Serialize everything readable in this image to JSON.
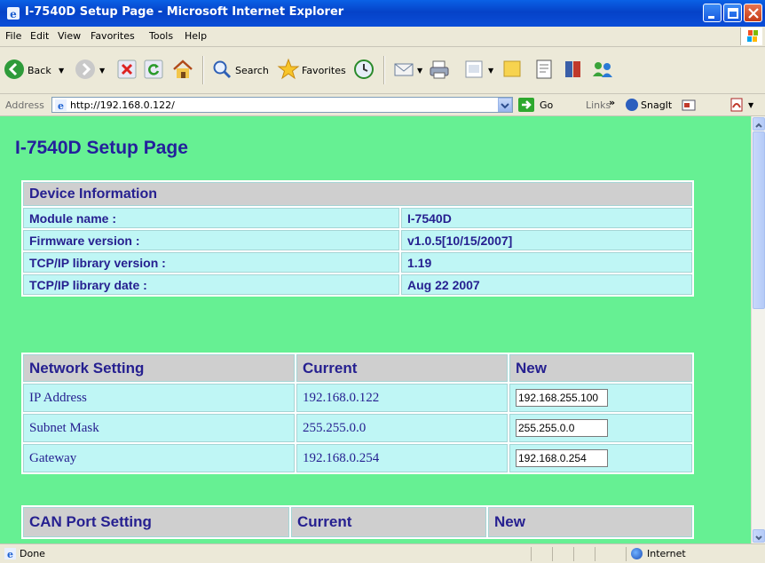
{
  "window": {
    "title": "I-7540D Setup Page - Microsoft Internet Explorer"
  },
  "menu": [
    "File",
    "Edit",
    "View",
    "Favorites",
    "Tools",
    "Help"
  ],
  "toolbar": {
    "back": "Back",
    "search": "Search",
    "favorites": "Favorites"
  },
  "address": {
    "label": "Address",
    "url": "http://192.168.0.122/",
    "go": "Go",
    "links": "Links",
    "snagit": "SnagIt"
  },
  "page": {
    "title": "I-7540D Setup Page",
    "device_info": {
      "header": "Device Information",
      "rows": [
        {
          "label": "Module name :",
          "value": "I-7540D"
        },
        {
          "label": "Firmware version :",
          "value": "v1.0.5[10/15/2007]"
        },
        {
          "label": "TCP/IP library version :",
          "value": "1.19"
        },
        {
          "label": "TCP/IP library date :",
          "value": "Aug 22 2007"
        }
      ]
    },
    "network": {
      "headers": [
        "Network Setting",
        "Current",
        "New"
      ],
      "rows": [
        {
          "label": "IP Address",
          "current": "192.168.0.122",
          "new": "192.168.255.100"
        },
        {
          "label": "Subnet Mask",
          "current": "255.255.0.0",
          "new": "255.255.0.0"
        },
        {
          "label": "Gateway",
          "current": "192.168.0.254",
          "new": "192.168.0.254"
        }
      ]
    },
    "can": {
      "headers": [
        "CAN Port Setting",
        "Current",
        "New"
      ]
    }
  },
  "status": {
    "text": "Done",
    "zone": "Internet"
  },
  "colors": {
    "page_bg": "#66f093",
    "cell_bg": "#bff6f5",
    "header_bg": "#cfcfcf",
    "text": "#262090",
    "titlebar": "#0542c8"
  }
}
